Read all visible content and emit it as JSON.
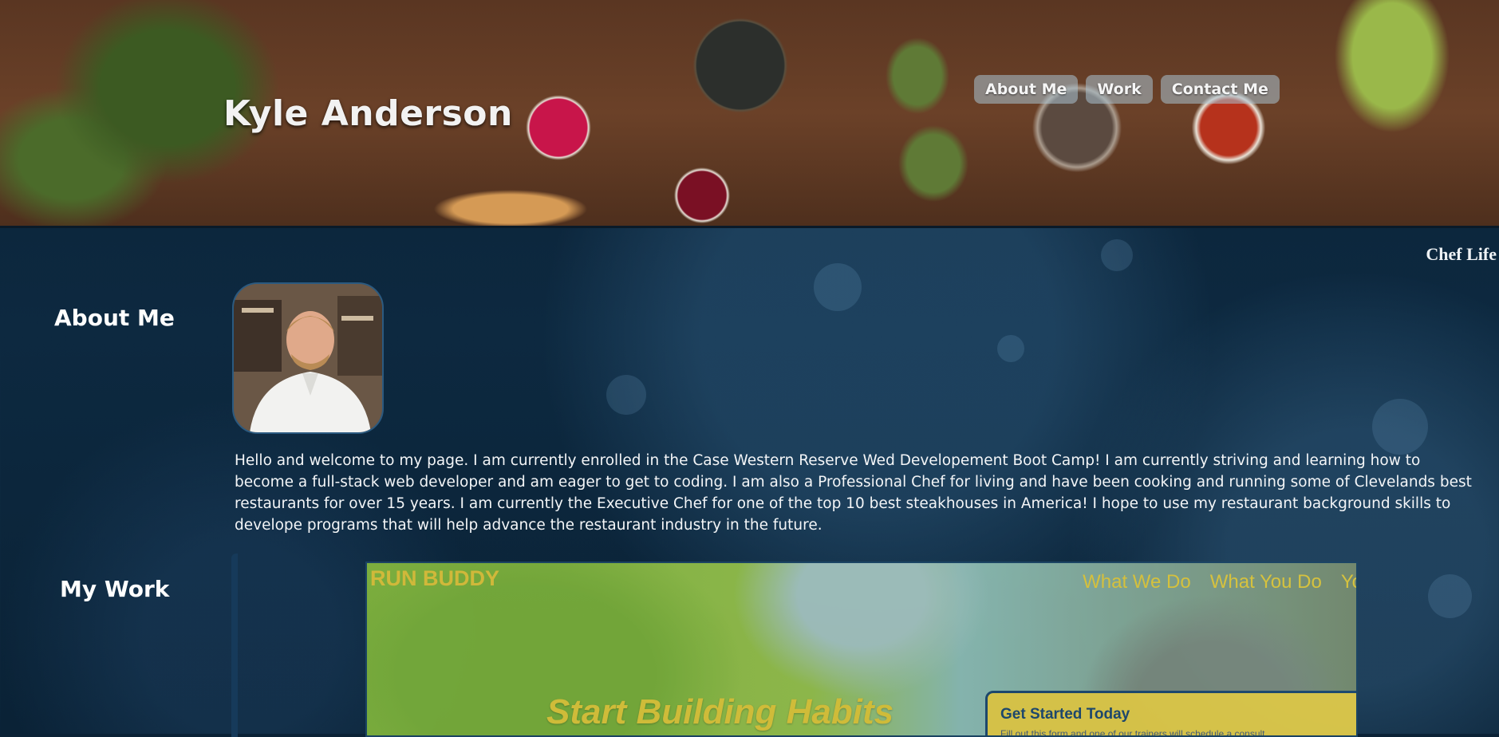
{
  "header": {
    "title": "Kyle Anderson",
    "nav": [
      "About Me",
      "Work",
      "Contact Me"
    ],
    "tagline": "Chef Life"
  },
  "about": {
    "heading": "About Me",
    "text": "Hello and welcome to my page. I am currently enrolled in the Case Western Reserve Wed Developement Boot Camp! I am currently striving and learning how to become a full-stack web developer and am eager to get to coding. I am also a Professional Chef for living and have been cooking and running some of Clevelands best restaurants for over 15 years. I am currently the Executive Chef for one of the top 10 best steakhouses in America! I hope to use my restaurant background skills to develope programs that will help advance the restaurant industry in the future."
  },
  "work": {
    "heading": "My Work",
    "project": {
      "brand": "RUN BUDDY",
      "nav": [
        "What We Do",
        "What You Do",
        "Yo"
      ],
      "headline": "Start Building Habits",
      "form_title": "Get Started Today",
      "form_subtitle": "Fill out this form and one of our trainers will schedule a consult"
    }
  },
  "colors": {
    "page_bg": "#0d2940",
    "project_accent": "#e1c53a",
    "form_border": "#1f4b71"
  }
}
